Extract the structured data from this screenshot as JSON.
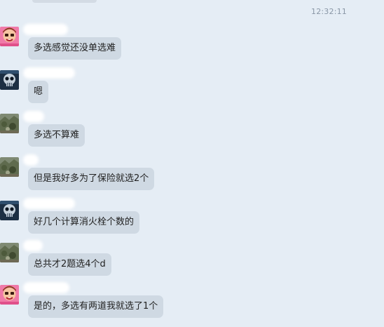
{
  "timestamp": "12:32:11",
  "messages": [
    {
      "avatar": "pink-cartoon-avatar-icon",
      "text": "多选感觉还没单选难"
    },
    {
      "avatar": "skull-avatar-icon",
      "text": "嗯"
    },
    {
      "avatar": "landscape-avatar-icon",
      "text": "多选不算难"
    },
    {
      "avatar": "landscape-avatar-icon",
      "text": "但是我好多为了保险就选2个"
    },
    {
      "avatar": "skull-avatar-icon",
      "text": "好几个计算消火栓个数的"
    },
    {
      "avatar": "landscape-avatar-icon",
      "text": "总共才2题选4个d"
    },
    {
      "avatar": "pink-cartoon-avatar-icon",
      "text": "是的，多选有两道我就选了1个"
    }
  ]
}
